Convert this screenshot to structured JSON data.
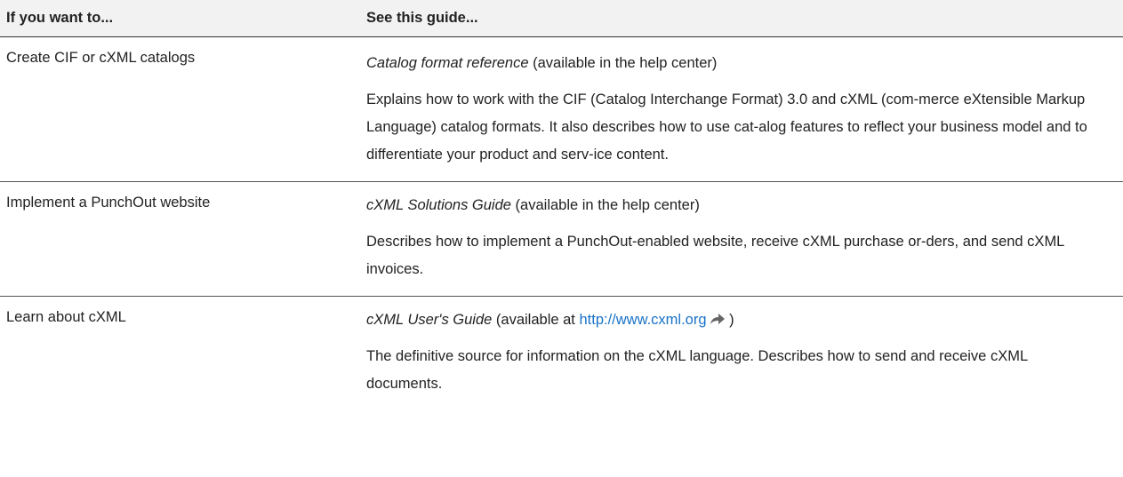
{
  "table": {
    "header": {
      "col1": "If you want to...",
      "col2": "See this guide..."
    },
    "rows": [
      {
        "want": "Create CIF or cXML catalogs",
        "guide_title": "Catalog format reference",
        "guide_suffix": " (available in the help center)",
        "description": "Explains how to work with the CIF (Catalog Interchange Format) 3.0 and cXML (com-merce eXtensible Markup Language) catalog formats. It also describes how to use cat-alog features to reflect your business model and to differentiate your product and serv-ice content."
      },
      {
        "want": "Implement a PunchOut website",
        "guide_title": "cXML Solutions Guide",
        "guide_suffix": " (available in the help center)",
        "description": "Describes how to implement a PunchOut-enabled website, receive cXML purchase or-ders, and send cXML invoices."
      },
      {
        "want": "Learn about cXML",
        "guide_title": "cXML User's Guide",
        "guide_prefix": " (available at ",
        "link": "http://www.cxml.org",
        "link_icon": "external-link-icon",
        "guide_close": " )",
        "description": "The definitive source for information on the cXML language. Describes how to send and receive cXML documents."
      }
    ]
  }
}
